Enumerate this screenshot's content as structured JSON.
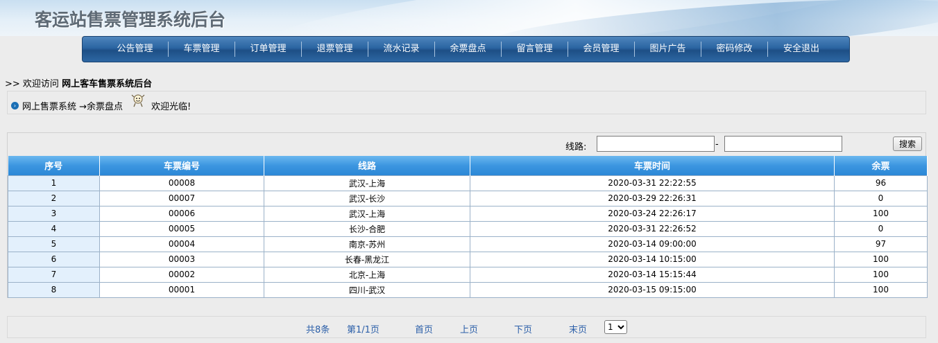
{
  "header": {
    "title": "客运站售票管理系统后台"
  },
  "nav": {
    "items": [
      "公告管理",
      "车票管理",
      "订单管理",
      "退票管理",
      "流水记录",
      "余票盘点",
      "留言管理",
      "会员管理",
      "图片广告",
      "密码修改",
      "安全退出"
    ]
  },
  "welcome": {
    "prefix": ">> 欢迎访问",
    "site": "网上客车售票系统后台"
  },
  "breadcrumb": {
    "text": "网上售票系统 →余票盘点",
    "greeting": "欢迎光临!"
  },
  "search": {
    "label": "线路:",
    "from_value": "",
    "to_value": "",
    "dash": "-",
    "button": "搜索"
  },
  "table": {
    "headers": [
      "序号",
      "车票编号",
      "线路",
      "车票时间",
      "余票"
    ],
    "rows": [
      [
        "1",
        "00008",
        "武汉-上海",
        "2020-03-31 22:22:55",
        "96"
      ],
      [
        "2",
        "00007",
        "武汉-长沙",
        "2020-03-29 22:26:31",
        "0"
      ],
      [
        "3",
        "00006",
        "武汉-上海",
        "2020-03-24 22:26:17",
        "100"
      ],
      [
        "4",
        "00005",
        "长沙-合肥",
        "2020-03-31 22:26:52",
        "0"
      ],
      [
        "5",
        "00004",
        "南京-苏州",
        "2020-03-14 09:00:00",
        "97"
      ],
      [
        "6",
        "00003",
        "长春-黑龙江",
        "2020-03-14 10:15:00",
        "100"
      ],
      [
        "7",
        "00002",
        "北京-上海",
        "2020-03-14 15:15:44",
        "100"
      ],
      [
        "8",
        "00001",
        "四川-武汉",
        "2020-03-15 09:15:00",
        "100"
      ]
    ]
  },
  "pager": {
    "total": "共8条",
    "page": "第1/1页",
    "first": "首页",
    "prev": "上页",
    "next": "下页",
    "last": "末页",
    "select_value": "1"
  }
}
